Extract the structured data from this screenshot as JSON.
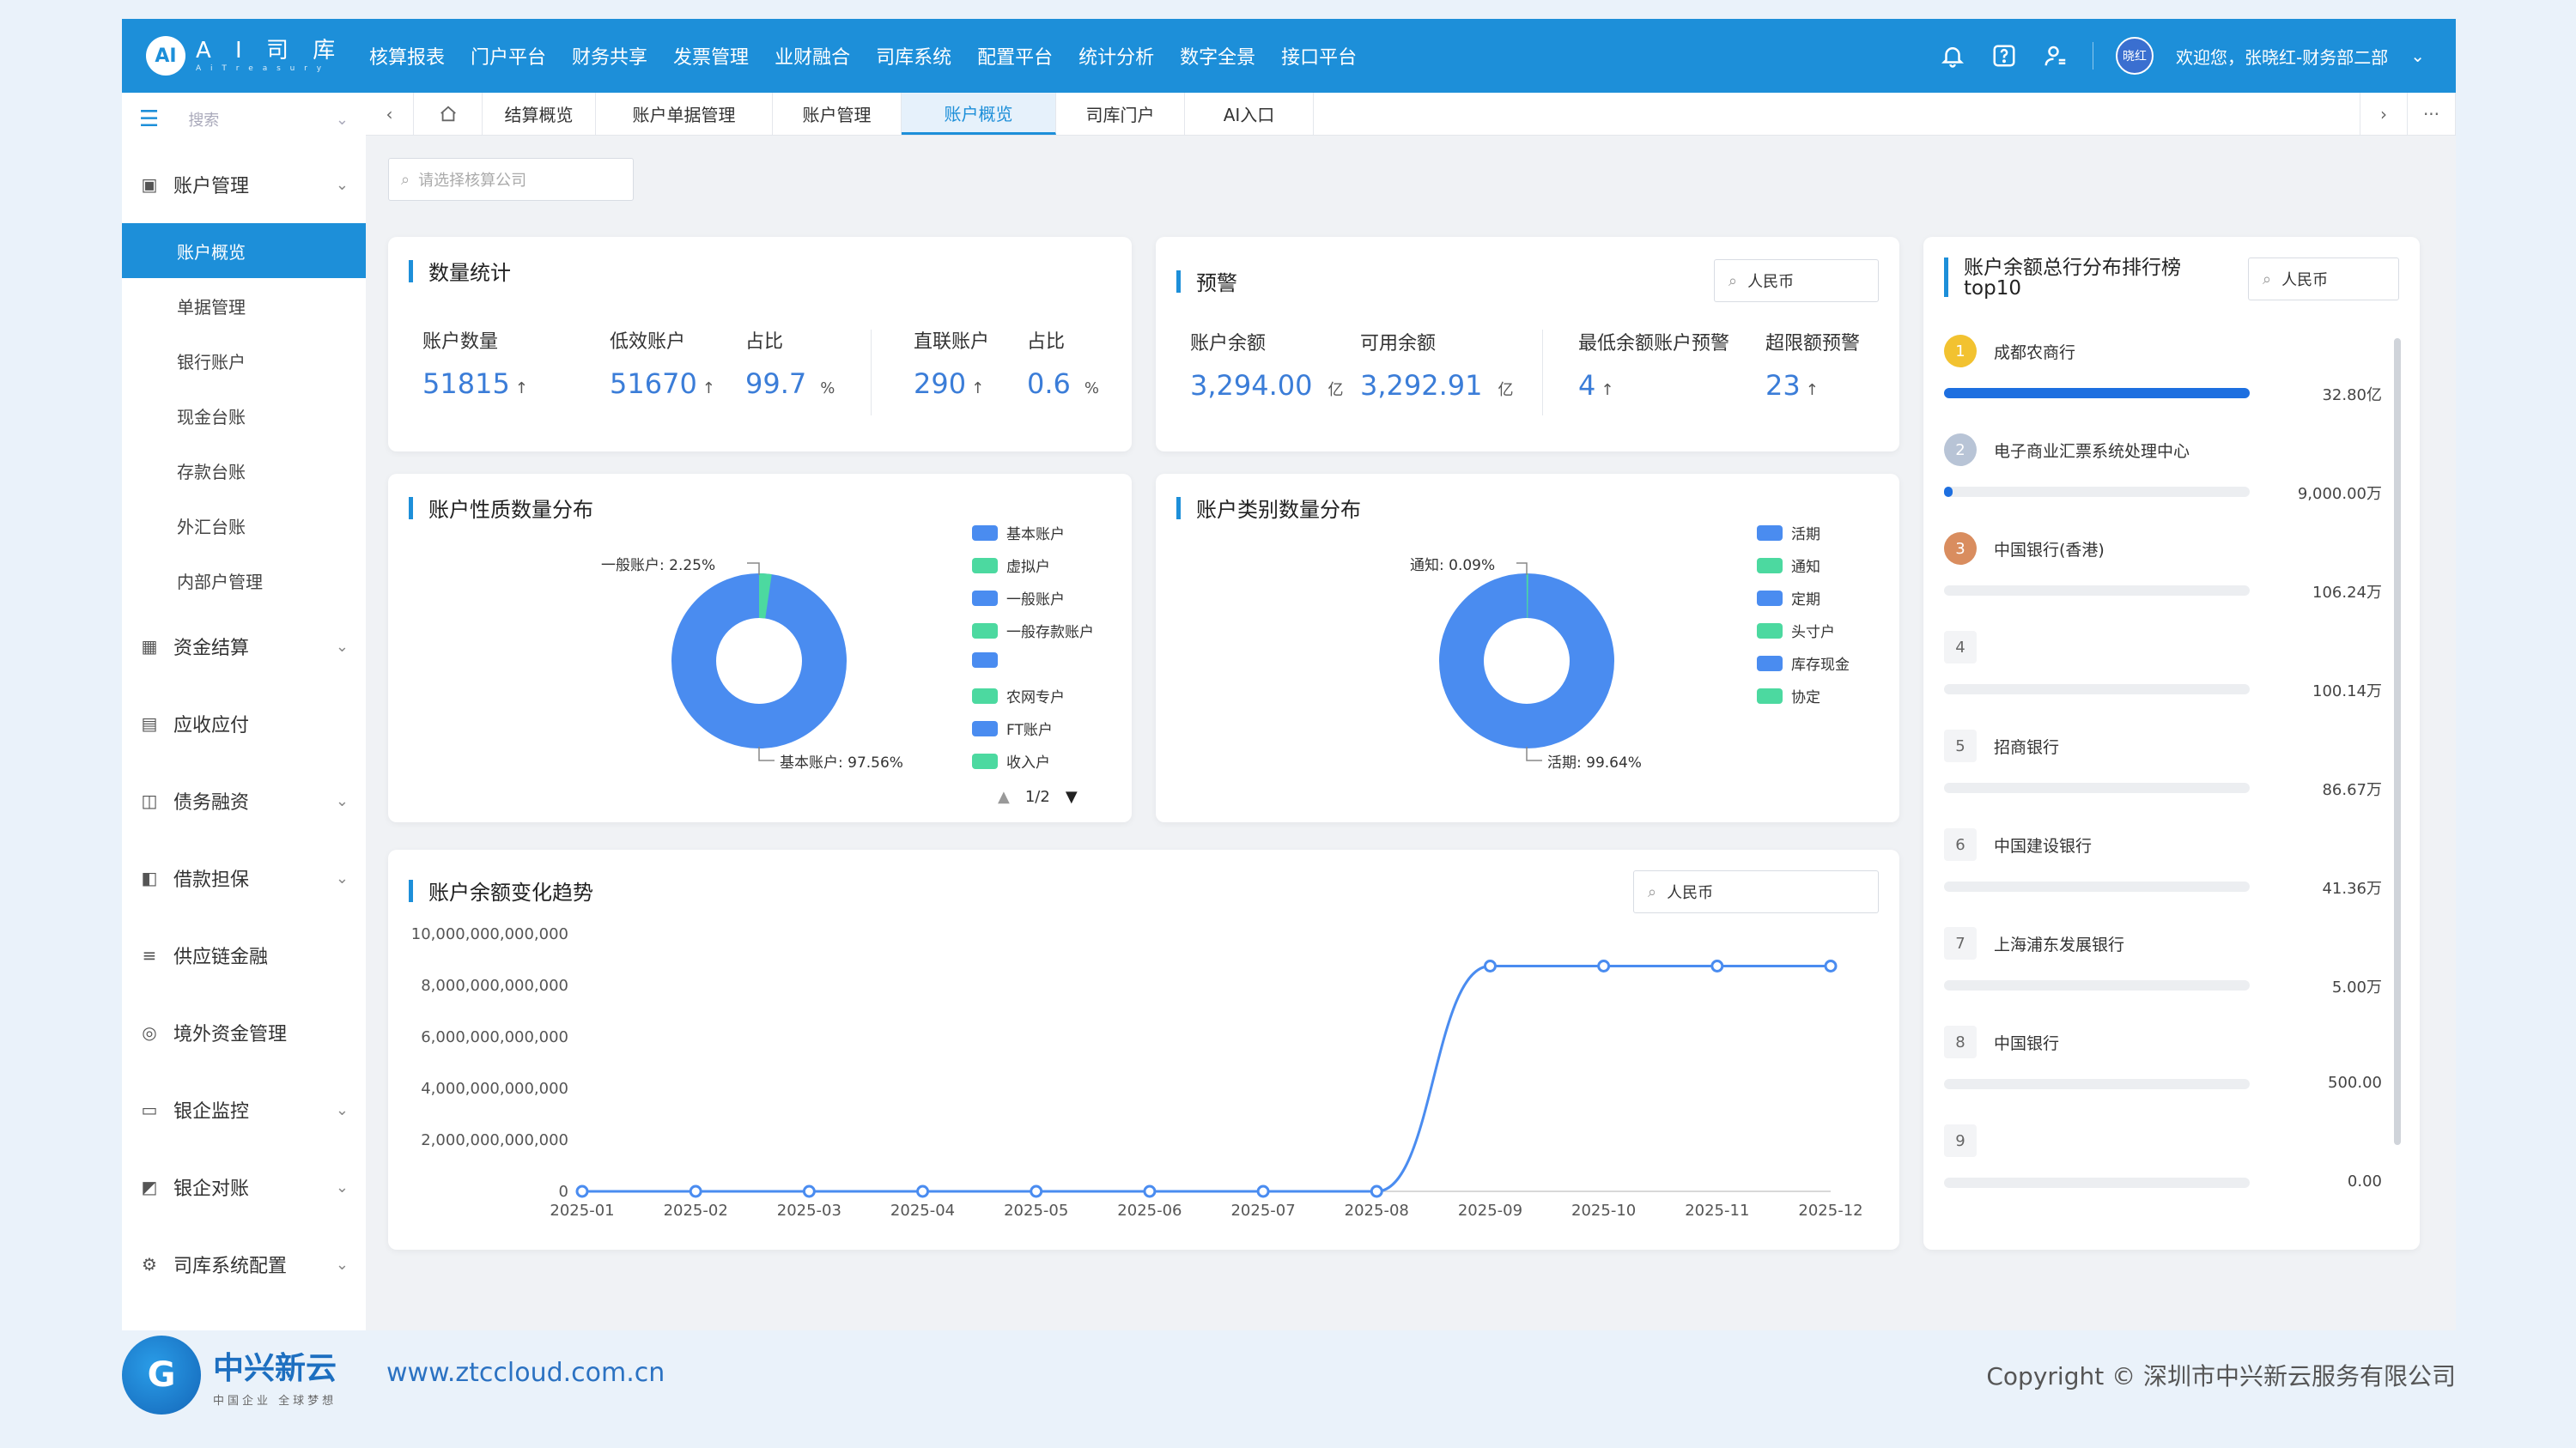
{
  "brand": {
    "logo_text": "AI",
    "name": "A I 司 库",
    "sub": "A i  T r e a s u r y"
  },
  "topnav": [
    "核算报表",
    "门户平台",
    "财务共享",
    "发票管理",
    "业财融合",
    "司库系统",
    "配置平台",
    "统计分析",
    "数字全景",
    "接口平台"
  ],
  "user": {
    "avatar": "晓红",
    "welcome": "欢迎您，张晓红-财务部二部"
  },
  "sidebar": {
    "search_placeholder": "搜索",
    "groups": [
      {
        "label": "账户管理",
        "icon": "account-icon",
        "expanded": true,
        "items": [
          "账户概览",
          "单据管理",
          "银行账户",
          "现金台账",
          "存款台账",
          "外汇台账",
          "内部户管理"
        ],
        "active": "账户概览"
      },
      {
        "label": "资金结算",
        "icon": "settlement-icon"
      },
      {
        "label": "应收应付",
        "icon": "receivable-icon"
      },
      {
        "label": "债务融资",
        "icon": "debt-icon"
      },
      {
        "label": "借款担保",
        "icon": "guarantee-icon"
      },
      {
        "label": "供应链金融",
        "icon": "supply-chain-icon"
      },
      {
        "label": "境外资金管理",
        "icon": "overseas-icon"
      },
      {
        "label": "银企监控",
        "icon": "monitor-icon"
      },
      {
        "label": "银企对账",
        "icon": "reconcile-icon"
      },
      {
        "label": "司库系统配置",
        "icon": "config-icon"
      }
    ]
  },
  "tabs": [
    "结算概览",
    "账户单据管理",
    "账户管理",
    "账户概览",
    "司库门户",
    "AI入口"
  ],
  "active_tab": "账户概览",
  "filter": {
    "placeholder": "请选择核算公司"
  },
  "stats": {
    "title": "数量统计",
    "account_count_label": "账户数量",
    "account_count": "51815",
    "invalid_label": "低效账户",
    "invalid": "51670",
    "ratio_label": "占比",
    "ratio": "99.7",
    "ratio_unit": "%",
    "direct_label": "直联账户",
    "direct": "290",
    "direct_ratio_label": "占比",
    "direct_ratio": "0.6",
    "direct_ratio_unit": "%",
    "arrow": "↑"
  },
  "warning": {
    "title": "预警",
    "currency": "人民币",
    "balance_label": "账户余额",
    "balance": "3,294.00",
    "balance_unit": "亿",
    "available_label": "可用余额",
    "available": "3,292.91",
    "available_unit": "亿",
    "min_label": "最低余额账户预警",
    "min": "4",
    "over_label": "超限额预警",
    "over": "23",
    "arrow": "↑"
  },
  "nature_chart": {
    "title": "账户性质数量分布",
    "label_top": "一般账户: 2.25%",
    "label_bottom": "基本账户: 97.56%",
    "legend": [
      {
        "name": "基本账户",
        "color": "#4a8cf0"
      },
      {
        "name": "虚拟户",
        "color": "#4cd9a0"
      },
      {
        "name": "一般账户",
        "color": "#4a8cf0"
      },
      {
        "name": "一般存款账户",
        "color": "#4cd9a0"
      },
      {
        "name": "",
        "color": "#4a8cf0"
      },
      {
        "name": "农网专户",
        "color": "#4cd9a0"
      },
      {
        "name": "FT账户",
        "color": "#4a8cf0"
      },
      {
        "name": "收入户",
        "color": "#4cd9a0"
      }
    ],
    "pager": "1/2"
  },
  "type_chart": {
    "title": "账户类别数量分布",
    "label_top": "通知: 0.09%",
    "label_bottom": "活期: 99.64%",
    "legend": [
      {
        "name": "活期",
        "color": "#4a8cf0"
      },
      {
        "name": "通知",
        "color": "#4cd9a0"
      },
      {
        "name": "定期",
        "color": "#4a8cf0"
      },
      {
        "name": "头寸户",
        "color": "#4cd9a0"
      },
      {
        "name": "库存现金",
        "color": "#4a8cf0"
      },
      {
        "name": "协定",
        "color": "#4cd9a0"
      }
    ]
  },
  "ranking": {
    "title": "账户余额总行分布排行榜",
    "title2": "top10",
    "currency": "人民币",
    "items": [
      {
        "rank": "1",
        "name": "成都农商行",
        "value": "32.80亿",
        "ratio": 1.0,
        "medal": "gold"
      },
      {
        "rank": "2",
        "name": "电子商业汇票系统处理中心",
        "value": "9,000.00万",
        "ratio": 0.027,
        "medal": "silver"
      },
      {
        "rank": "3",
        "name": "中国银行(香港)",
        "value": "106.24万",
        "ratio": 0.0,
        "medal": "bronze"
      },
      {
        "rank": "4",
        "name": "",
        "value": "100.14万",
        "ratio": 0.0
      },
      {
        "rank": "5",
        "name": "招商银行",
        "value": "86.67万",
        "ratio": 0.0
      },
      {
        "rank": "6",
        "name": "中国建设银行",
        "value": "41.36万",
        "ratio": 0.0
      },
      {
        "rank": "7",
        "name": "上海浦东发展银行",
        "value": "5.00万",
        "ratio": 0.0
      },
      {
        "rank": "8",
        "name": "中国银行",
        "value": "500.00",
        "ratio": 0.0
      },
      {
        "rank": "9",
        "name": "",
        "value": "0.00",
        "ratio": 0.0
      }
    ]
  },
  "chart_data": {
    "type": "line",
    "title": "账户余额变化趋势",
    "currency": "人民币",
    "x": [
      "2025-01",
      "2025-02",
      "2025-03",
      "2025-04",
      "2025-05",
      "2025-06",
      "2025-07",
      "2025-08",
      "2025-09",
      "2025-10",
      "2025-11",
      "2025-12"
    ],
    "values": [
      0,
      0,
      0,
      0,
      0,
      0,
      0,
      0,
      8750000000,
      8750000000,
      8750000000,
      8750000000
    ],
    "yticks": [
      "10,000,000,000,000",
      "8,000,000,000,000",
      "6,000,000,000,000",
      "4,000,000,000,000",
      "2,000,000,000,000",
      "0"
    ],
    "ylim": [
      0,
      10000000000
    ],
    "color": "#4a8cf0"
  },
  "footer": {
    "brand": "中兴新云",
    "brand_sub": "中国企业 全球梦想",
    "url": "www.ztccloud.com.cn",
    "copyright": "Copyright © 深圳市中兴新云服务有限公司"
  },
  "colors": {
    "primary": "#1d8fd9",
    "accent": "#3b7dd8",
    "green": "#4cd9a0"
  }
}
